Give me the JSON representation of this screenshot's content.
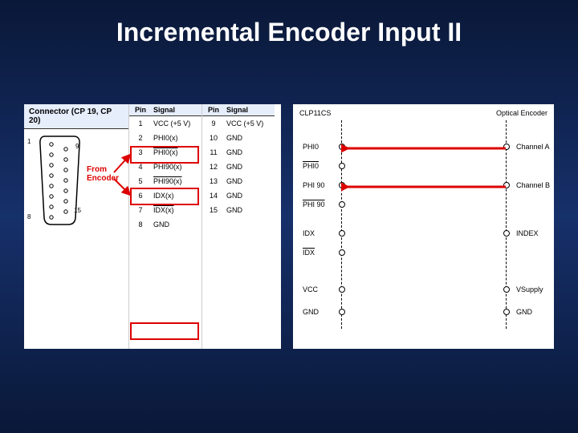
{
  "title": "Incremental Encoder Input II",
  "annotation": {
    "from_encoder": "From\nEncoder"
  },
  "left_panel": {
    "connector_header": "Connector (CP 19, CP 20)",
    "pin_col": "Pin",
    "signal_col": "Signal",
    "db15_top_pin": "9",
    "db15_left_top": "1",
    "db15_left_bot": "8",
    "db15_bot_pin": "15",
    "col_a": [
      {
        "pin": "1",
        "sig": "VCC (+5 V)",
        "over": false
      },
      {
        "pin": "2",
        "sig": "PHI0(x)",
        "over": false
      },
      {
        "pin": "3",
        "sig": "PHI0(x)",
        "over": true
      },
      {
        "pin": "4",
        "sig": "PHI90(x)",
        "over": false
      },
      {
        "pin": "5",
        "sig": "PHI90(x)",
        "over": true
      },
      {
        "pin": "6",
        "sig": "IDX(x)",
        "over": false
      },
      {
        "pin": "7",
        "sig": "IDX(x)",
        "over": true
      },
      {
        "pin": "8",
        "sig": "GND",
        "over": false
      }
    ],
    "col_b": [
      {
        "pin": "9",
        "sig": "VCC (+5 V)",
        "over": false
      },
      {
        "pin": "10",
        "sig": "GND",
        "over": false
      },
      {
        "pin": "11",
        "sig": "GND",
        "over": false
      },
      {
        "pin": "12",
        "sig": "GND",
        "over": false
      },
      {
        "pin": "13",
        "sig": "GND",
        "over": false
      },
      {
        "pin": "14",
        "sig": "GND",
        "over": false
      },
      {
        "pin": "15",
        "sig": "GND",
        "over": false
      }
    ]
  },
  "right_panel": {
    "left_title": "CLP11CS",
    "right_title": "Optical Encoder",
    "left_signals": [
      {
        "name": "PHI0",
        "over": false
      },
      {
        "name": "PHI0",
        "over": true
      },
      {
        "name": "PHI 90",
        "over": false
      },
      {
        "name": "PHI 90",
        "over": true
      },
      {
        "name": "IDX",
        "over": false
      },
      {
        "name": "IDX",
        "over": true
      },
      {
        "name": "VCC",
        "over": false
      },
      {
        "name": "GND",
        "over": false
      }
    ],
    "right_signals": [
      {
        "name": "Channel A"
      },
      {
        "name": "Channel B"
      },
      {
        "name": "INDEX"
      },
      {
        "name": "VSupply"
      },
      {
        "name": "GND"
      }
    ]
  }
}
